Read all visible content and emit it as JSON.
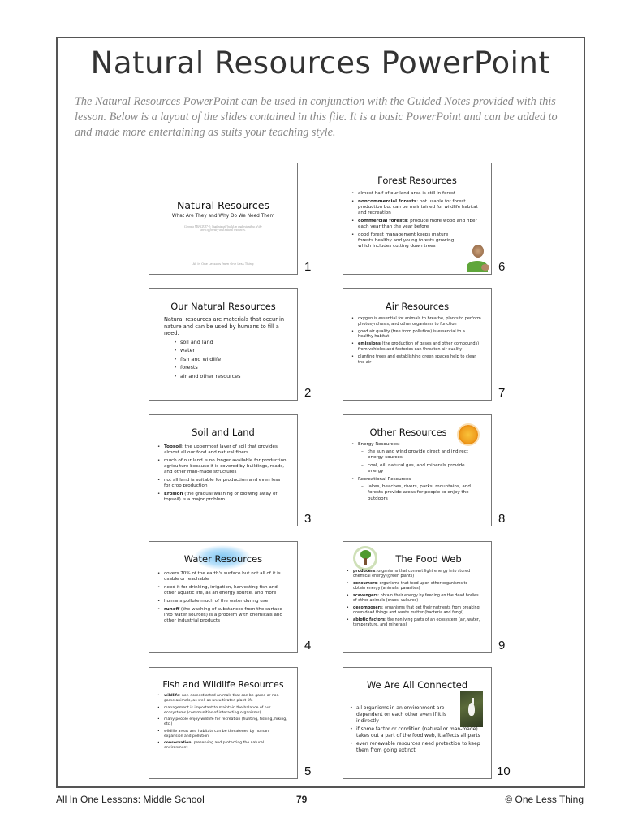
{
  "page": {
    "title": "Natural Resources PowerPoint",
    "intro": "The Natural Resources PowerPoint can be used in conjunction with the Guided Notes provided with this lesson. Below is a layout of the slides contained in this file. It is a basic PowerPoint and can be added to and made more entertaining as suits your teaching style."
  },
  "slides": [
    {
      "number": "1",
      "title": "Natural Resources",
      "subtitle": "What Are They and Why Do We Need Them",
      "standard": "Georgia MSACED7-3: Students will build an understanding of the area of forestry and natural resources.",
      "credit": "All In One Lessons from One Less Thing"
    },
    {
      "number": "2",
      "title": "Our Natural Resources",
      "intro": "Natural resources are materials that occur in nature and can be used by humans to fill a need.",
      "bullets": [
        "soil and land",
        "water",
        "fish and wildlife",
        "forests",
        "air and other resources"
      ]
    },
    {
      "number": "3",
      "title": "Soil and Land",
      "bullets": [
        {
          "bold": "Topsoil",
          "text": ": the uppermost layer of soil that provides almost all our food and natural fibers"
        },
        {
          "bold": "",
          "text": "much of our land is no longer available for production agriculture because it is covered by buildings, roads, and other man-made structures"
        },
        {
          "bold": "",
          "text": "not all land is suitable for production and even less for crop production"
        },
        {
          "bold": "Erosion",
          "text": " (the gradual washing or blowing away of topsoil) is a major problem"
        }
      ]
    },
    {
      "number": "4",
      "title": "Water Resources",
      "bullets": [
        {
          "bold": "",
          "text": "covers 70% of the earth's surface but not all of it is usable or reachable"
        },
        {
          "bold": "",
          "text": "need it for drinking, irrigation, harvesting fish and other aquatic life, as an energy source, and more"
        },
        {
          "bold": "",
          "text": "humans pollute much of the water during use"
        },
        {
          "bold": "runoff",
          "text": " (the washing of substances from the surface into water sources) is a problem with chemicals and other industrial products"
        }
      ]
    },
    {
      "number": "5",
      "title": "Fish and Wildlife Resources",
      "bullets": [
        {
          "bold": "wildlife",
          "text": ": non-domesticated animals that can be game or non-game animals, as well as uncultivated plant life"
        },
        {
          "bold": "",
          "text": "management is important to maintain the balance of our ecosystems (communities of interacting organisms)"
        },
        {
          "bold": "",
          "text": "many people enjoy wildlife for recreation (hunting, fishing, hiking, etc.)"
        },
        {
          "bold": "",
          "text": "wildlife areas and habitats can be threatened by human expansion and pollution"
        },
        {
          "bold": "conservation",
          "text": ": preserving and protecting the natural environment"
        }
      ]
    },
    {
      "number": "6",
      "title": "Forest Resources",
      "bullets": [
        {
          "bold": "",
          "text": "almost half of our land area is still in forest"
        },
        {
          "bold": "noncommercial forests",
          "text": ": not usable for forest production but can be maintained for wildlife habitat and recreation"
        },
        {
          "bold": "commercial forests",
          "text": ": produce more wood and fiber each year than the year before"
        },
        {
          "bold": "",
          "text": "good forest management keeps mature forests healthy and young forests growing which includes cutting down trees"
        }
      ]
    },
    {
      "number": "7",
      "title": "Air Resources",
      "bullets": [
        {
          "bold": "",
          "text": "oxygen is essential for animals to breathe, plants to perform photosynthesis, and other organisms to function"
        },
        {
          "bold": "",
          "text": "good air quality (free from pollution) is essential to a healthy habitat"
        },
        {
          "bold": "emissions",
          "text": " (the production of gases and other compounds) from vehicles and factories can threaten air quality"
        },
        {
          "bold": "",
          "text": "planting trees and establishing green spaces help to clean the air"
        }
      ]
    },
    {
      "number": "8",
      "title": "Other Resources",
      "groups": [
        {
          "label": "Energy Resources:",
          "items": [
            "the sun and wind provide direct and indirect energy sources",
            "coal, oil, natural gas, and minerals provide energy"
          ]
        },
        {
          "label": "Recreational Resources",
          "items": [
            "lakes, beaches, rivers, parks, mountains, and forests provide areas for people to enjoy the outdoors"
          ]
        }
      ]
    },
    {
      "number": "9",
      "title": "The Food Web",
      "bullets": [
        {
          "bold": "producers",
          "text": ": organisms that convert light energy into stored chemical energy (green plants)"
        },
        {
          "bold": "consumers",
          "text": ": organisms that feed upon other organisms to obtain energy (animals, parasites)"
        },
        {
          "bold": "scavengers",
          "text": ": obtain their energy by feeding on the dead bodies of other animals (crabs, vultures)"
        },
        {
          "bold": "decomposers",
          "text": ": organisms that get their nutrients from breaking down dead things and waste matter (bacteria and fungi)"
        },
        {
          "bold": "abiotic factors",
          "text": ": the nonliving parts of an ecosystem (air, water, temperature, and minerals)"
        }
      ]
    },
    {
      "number": "10",
      "title": "We Are All Connected",
      "bullets": [
        {
          "bold": "",
          "text": "all organisms in an environment are dependent on each other even if it is indirectly"
        },
        {
          "bold": "",
          "text": "if some factor or condition (natural or man-made) takes out a part of the food web, it affects all parts"
        },
        {
          "bold": "",
          "text": "even renewable resources need protection to keep them from going extinct"
        }
      ]
    }
  ],
  "footer": {
    "left": "All In One Lessons: Middle School",
    "page_number": "79",
    "right": "© One Less Thing"
  }
}
